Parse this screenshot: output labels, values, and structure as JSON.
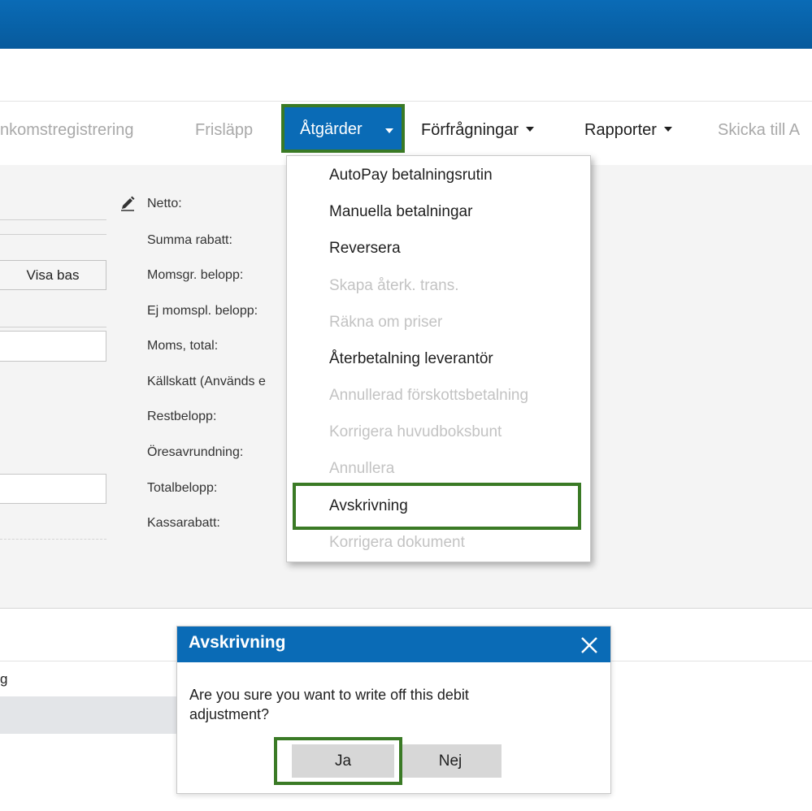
{
  "toolbar": {
    "items": [
      {
        "label": "nkomstregistrering",
        "disabled": true
      },
      {
        "label": "Frisläpp",
        "disabled": true
      },
      {
        "label": "Åtgärder",
        "active": true
      },
      {
        "label": "Förfrågningar"
      },
      {
        "label": "Rapporter"
      },
      {
        "label": "Skicka till A",
        "disabled": true
      }
    ]
  },
  "form": {
    "visa_bas_button": "Visa bas",
    "summary_labels": [
      "Netto:",
      "Summa rabatt:",
      "Momsgr. belopp:",
      "Ej momspl. belopp:",
      "Moms, total:",
      "Källskatt (Används e",
      "Restbelopp:",
      "Öresavrundning:",
      "Totalbelopp:",
      "Kassarabatt:"
    ]
  },
  "actions_menu": {
    "items": [
      {
        "label": "AutoPay betalningsrutin",
        "enabled": true
      },
      {
        "label": "Manuella betalningar",
        "enabled": true
      },
      {
        "label": "Reversera",
        "enabled": true
      },
      {
        "label": "Skapa återk. trans.",
        "enabled": false
      },
      {
        "label": "Räkna om priser",
        "enabled": false
      },
      {
        "label": "Återbetalning leverantör",
        "enabled": true
      },
      {
        "label": "Annullerad förskottsbetalning",
        "enabled": false
      },
      {
        "label": "Korrigera huvudboksbunt",
        "enabled": false
      },
      {
        "label": "Annullera",
        "enabled": false
      },
      {
        "label": "Avskrivning",
        "enabled": true,
        "highlighted": true
      },
      {
        "label": "Korrigera dokument",
        "enabled": false
      }
    ]
  },
  "lower": {
    "truncated_text": "g"
  },
  "dialog": {
    "title": "Avskrivning",
    "message": "Are you sure you want to write off this debit adjustment?",
    "yes_label": "Ja",
    "no_label": "Nej"
  },
  "colors": {
    "brand_blue": "#0a6bb6",
    "highlight_green": "#3a7a25"
  },
  "icons": [
    "pencil-icon",
    "chevron-down-icon",
    "close-icon"
  ]
}
